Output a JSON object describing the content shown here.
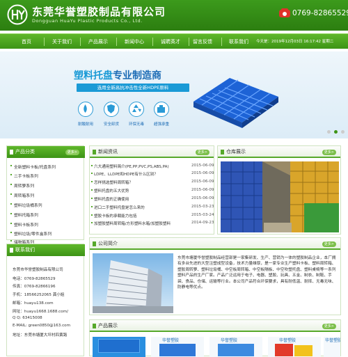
{
  "header": {
    "company_cn": "东莞华誉塑胶制品有限公司",
    "company_en": "Dongguan HuaYu Plastic Products Co., Ltd.",
    "phone": "0769-82865529"
  },
  "nav": {
    "items": [
      "首页",
      "关于我们",
      "产品展示",
      "新闻中心",
      "诚聘英才",
      "留言反馈",
      "联系我们"
    ],
    "datetime": "今天是：2019年12月03日 16:17:42 星期二"
  },
  "banner": {
    "title_a": "塑料托盘",
    "title_b": "专业制造商",
    "subtitle": "选用全新高抗冲击性全新HDPE原料",
    "features": [
      "耐酸耐用",
      "安全卸货",
      "环保无毒",
      "超强承重"
    ],
    "colors": {
      "accent": "#1a9ad6",
      "dark_blue": "#1b6bb5"
    }
  },
  "categories": {
    "title": "产品分类",
    "more": "更多>",
    "items": [
      "全新塑料卡板/托盘系列",
      "二手卡板系列",
      "周转箩系列",
      "周转箱系列",
      "塑料垃圾桶系列",
      "塑料托箱系列",
      "塑料卡板系列",
      "塑料垃圾/零件盒系列",
      "储物箱系列"
    ]
  },
  "contact": {
    "title": "联系我们",
    "lines": [
      "东莞市华誉塑胶制品有限公司",
      "电话：0769-82865529",
      "传真：0769-82866196",
      "手机：18566252065 龚小姐",
      "邮箱：huayu138.com",
      "网址：huayu1668.1688.com/",
      "Q  Q: 63415008",
      "E-MAIL: green0850@163.com",
      "地址：东莞市塘厦大坪村四黄路"
    ]
  },
  "news": {
    "title": "新闻资讯",
    "more": "更多>",
    "items": [
      {
        "title": "六大通用塑料简介(PE,PP,PVC,PS,ABS,PA)",
        "date": "2015-06-09"
      },
      {
        "title": "LDPE、LLDPE和HDPE有什么区别？",
        "date": "2015-06-09"
      },
      {
        "title": "怎样挑选塑料周转箱？",
        "date": "2015-06-09"
      },
      {
        "title": "塑料托盘的五大优势",
        "date": "2015-06-09"
      },
      {
        "title": "塑料托盘的正确使用",
        "date": "2015-06-09"
      },
      {
        "title": "进口二手塑料托盘是怎么来的",
        "date": "2015-03-23"
      },
      {
        "title": "塑胶卡板的承载能力包括",
        "date": "2015-03-24"
      },
      {
        "title": "加塑胶塑料周转箱/方形塑料水箱/加塑胶塑料",
        "date": "2014-09-23"
      }
    ]
  },
  "warehouse": {
    "title": "仓库展示",
    "more": "更多>"
  },
  "about": {
    "title": "公司简介",
    "more": "更多>",
    "text": "东莞市塘厦华誉塑胶制品经营部是一家集研发、生产、营销为一体的塑胶制品企业，本厂拥有多台先进的大型注塑成型设备，技术力量雄厚，是一家专业生产塑料卡板、塑料周转箱、塑胶周转箩、塑料垃圾桶、中空板周转箱、中空板隔板、中空吹塑托盘、塑料桌椅等一系列塑料产品的生产厂家。产品广泛运用于电子、电器、塑胶、玩具、五金、制衣、制鞋、手袋、食品、仓储、运输等行业。本公司产品符合环保要求，具有耐低温、耐摔、无毒无味、防静电等优点。"
  },
  "products": {
    "title": "产品展示",
    "more": "更多>",
    "labels": [
      "华誉塑胶",
      "华誉塑胶",
      "华誉塑胶",
      "华誉塑胶"
    ]
  }
}
